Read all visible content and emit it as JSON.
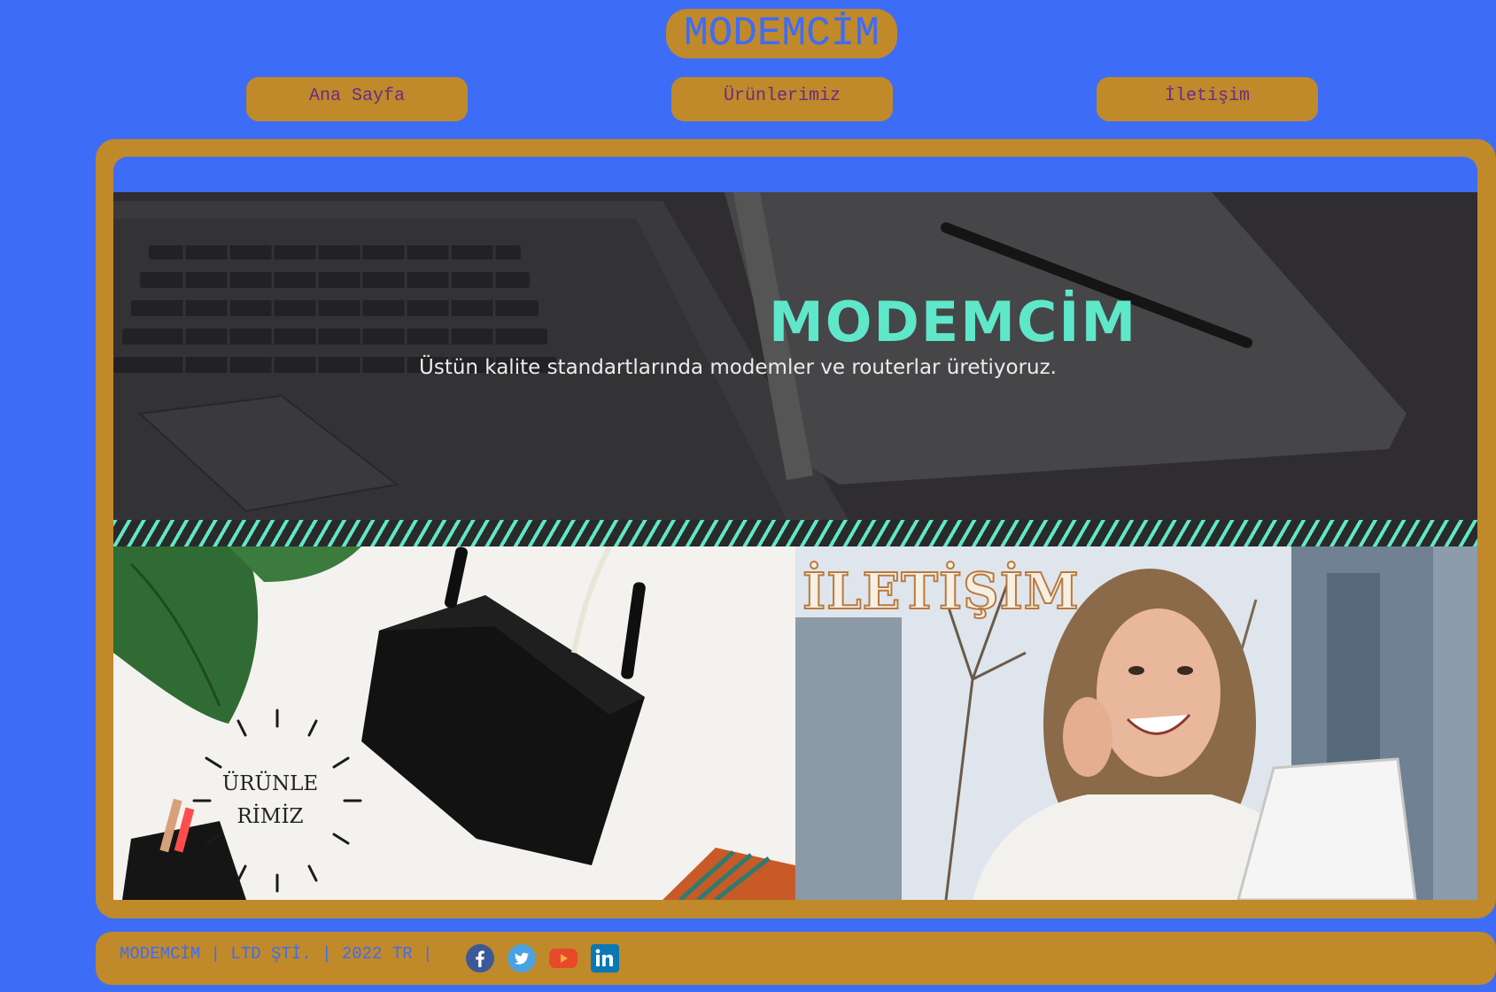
{
  "header": {
    "logo": "MODEMCİM"
  },
  "nav": {
    "items": [
      {
        "label": "Ana Sayfa"
      },
      {
        "label": "Ürünlerimiz"
      },
      {
        "label": "İletişim"
      }
    ]
  },
  "hero": {
    "title": "MODEMCİM",
    "subtitle": "Üstün kalite standartlarında modemler ve routerlar üretiyoruz."
  },
  "tiles": {
    "products": {
      "line1": "ÜRÜNLE",
      "line2": "RİMİZ"
    },
    "contact": {
      "label": "İLETİŞİM"
    }
  },
  "footer": {
    "text": "MODEMCİM | LTD ŞTİ. | 2022 TR |",
    "social": [
      "facebook-icon",
      "twitter-icon",
      "youtube-icon",
      "linkedin-icon"
    ]
  },
  "colors": {
    "background": "#3d6cf7",
    "gold": "#c0892a",
    "accent": "#5fe7c9",
    "nav_text": "#6a2b86"
  }
}
